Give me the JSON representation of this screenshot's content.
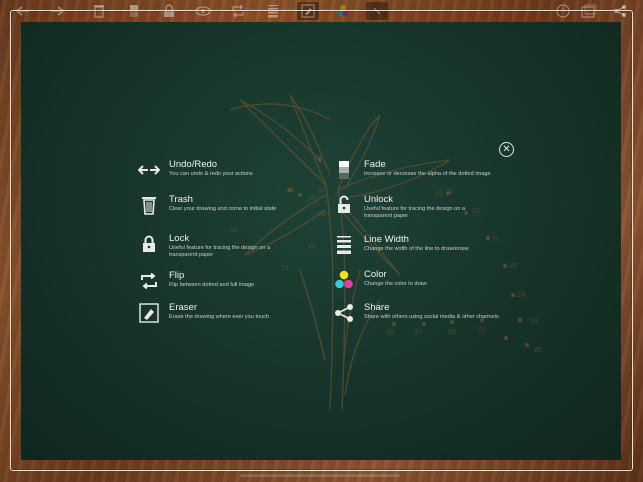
{
  "help": {
    "left": [
      {
        "title": "Undo/Redo",
        "desc": "You can undo & redo your actions"
      },
      {
        "title": "Trash",
        "desc": "Clear your drawing and come to initial state"
      },
      {
        "title": "Lock",
        "desc": "Useful feature for tracing the design on a transparent paper"
      },
      {
        "title": "Flip",
        "desc": "Flip between dotted and full image"
      },
      {
        "title": "Eraser",
        "desc": "Erase the drawing where ever you touch"
      }
    ],
    "right": [
      {
        "title": "Fade",
        "desc": "Increase or decrease the alpha of the dotted image"
      },
      {
        "title": "Unlock",
        "desc": "Useful feature for tracing the design on a transparent paper"
      },
      {
        "title": "Line Width",
        "desc": "Change the width of the line to draw/erase"
      },
      {
        "title": "Color",
        "desc": "Change the color to draw"
      },
      {
        "title": "Share",
        "desc": "Share with others using social media & other channels"
      }
    ]
  },
  "icons": {
    "toolbar": [
      "undo-icon",
      "redo-icon",
      "trash-icon",
      "fade-icon",
      "lock-icon",
      "eye-icon",
      "flip-icon",
      "line-width-icon",
      "eraser-icon",
      "color-icon",
      "redo-active-icon",
      "help-icon",
      "gallery-icon",
      "share-icon"
    ]
  },
  "colors": {
    "board": "#173329",
    "wood": "#7a4623",
    "drawing": "#8a6a3a",
    "color_yellow": "#f5e400",
    "color_cyan": "#34c8e0",
    "color_magenta": "#e0409a"
  },
  "dot_numbers": [
    "18",
    "16",
    "17",
    "10",
    "11",
    "15",
    "14",
    "13",
    "12",
    "20",
    "19",
    "21",
    "22",
    "23",
    "24",
    "25",
    "26",
    "27",
    "28",
    "29"
  ]
}
